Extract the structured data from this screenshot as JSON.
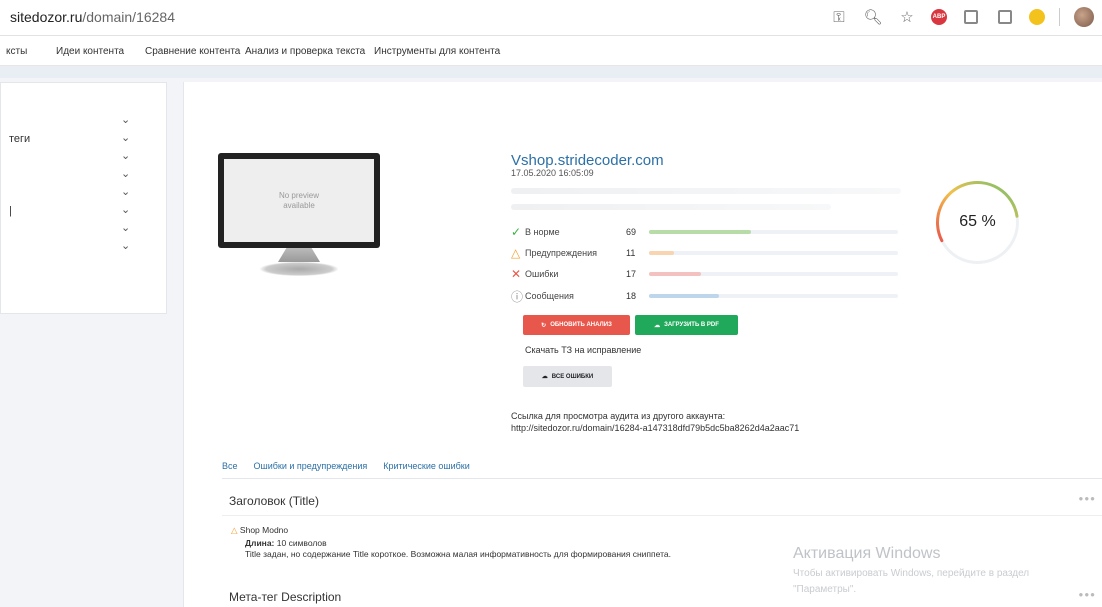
{
  "browser": {
    "url_host": "sitedozor.ru",
    "url_path": "/domain/16284"
  },
  "topnav": {
    "items": [
      "ксты",
      "Идеи контента",
      "Сравнение контента",
      "Анализ и проверка текста",
      "Инструменты для контента"
    ]
  },
  "sidebar": {
    "labels": [
      "теги",
      "|"
    ]
  },
  "preview": {
    "text_line1": "No preview",
    "text_line2": "available"
  },
  "site": {
    "title": "Vshop.stridecoder.com",
    "date": "17.05.2020 16:05:09"
  },
  "stats": [
    {
      "label": "В норме",
      "value": 69,
      "fraction": 0.41,
      "color": "#b8dca8",
      "icon": "check-icon",
      "glyph": "✓",
      "icon_color": "#3cb043"
    },
    {
      "label": "Предупреждения",
      "value": 11,
      "fraction": 0.1,
      "color": "#f8d4b0",
      "icon": "warning-icon",
      "glyph": "△",
      "icon_color": "#f0a030"
    },
    {
      "label": "Ошибки",
      "value": 17,
      "fraction": 0.21,
      "color": "#f3c2c0",
      "icon": "cross-icon",
      "glyph": "✕",
      "icon_color": "#e8574b"
    },
    {
      "label": "Сообщения",
      "value": 18,
      "fraction": 0.28,
      "color": "#bdd6ec",
      "icon": "info-icon",
      "glyph": "ⓘ",
      "icon_color": "#888888"
    }
  ],
  "buttons": {
    "refresh": "ОБНОВИТЬ АНАЛИЗ",
    "pdf": "ЗАГРУЗИТЬ В PDF",
    "all_errors": "ВСЕ ОШИБКИ"
  },
  "download_tz": "Скачать ТЗ на исправление",
  "audit": {
    "line1": "Ссылка для просмотра аудита из другого аккаунта:",
    "line2": "http://sitedozor.ru/domain/16284-a147318dfd79b5dc5ba8262d4a2aac71"
  },
  "score": {
    "value": 65,
    "text": "65 %"
  },
  "tabs": [
    "Все",
    "Ошибки и предупреждения",
    "Критические ошибки"
  ],
  "sections": {
    "title_heading": "Заголовок (Title)",
    "title_value": "Shop Modno",
    "length_label": "Длина:",
    "length_value": "10 символов",
    "title_note": "Title задан, но содержание Title короткое. Возможна малая информативность для формирования сниппета.",
    "meta_heading": "Мета-тег Description"
  },
  "watermark": {
    "title": "Активация Windows",
    "line1": "Чтобы активировать Windows, перейдите в раздел",
    "line2": "\"Параметры\"."
  }
}
